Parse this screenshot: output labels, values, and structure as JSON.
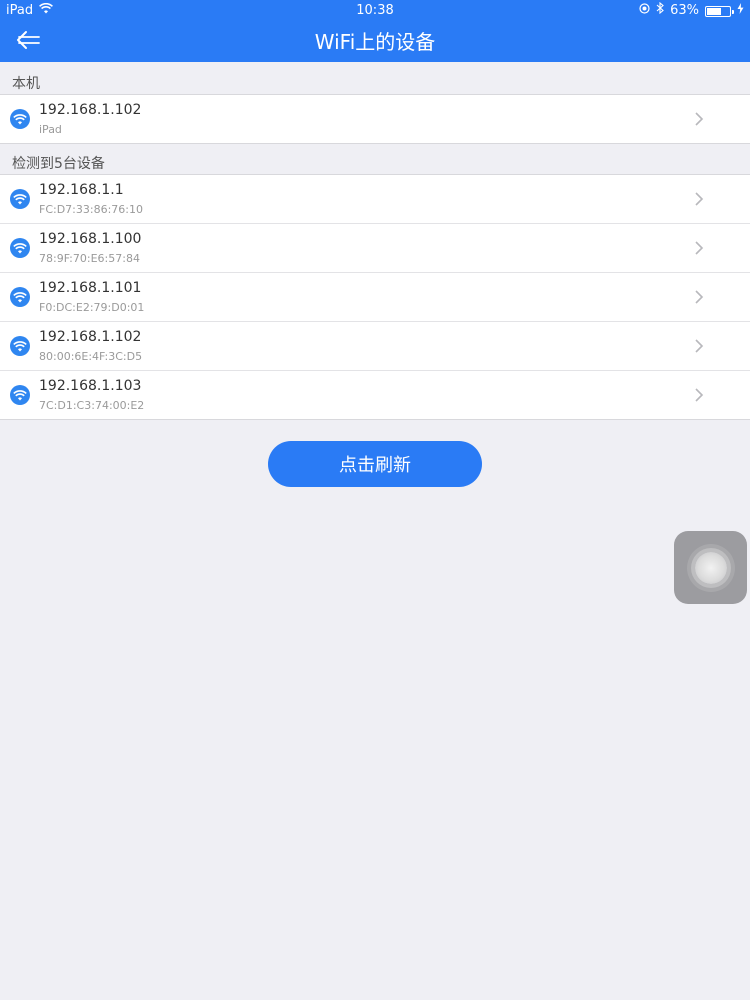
{
  "status_bar": {
    "device": "iPad",
    "time": "10:38",
    "battery": "63%",
    "battery_level": 0.63
  },
  "nav": {
    "title": "WiFi上的设备"
  },
  "local_section": {
    "header": "本机",
    "items": [
      {
        "ip": "192.168.1.102",
        "sub": "iPad"
      }
    ]
  },
  "detected_section": {
    "header": "检测到5台设备",
    "items": [
      {
        "ip": "192.168.1.1",
        "sub": "FC:D7:33:86:76:10"
      },
      {
        "ip": "192.168.1.100",
        "sub": "78:9F:70:E6:57:84"
      },
      {
        "ip": "192.168.1.101",
        "sub": "F0:DC:E2:79:D0:01"
      },
      {
        "ip": "192.168.1.102",
        "sub": "80:00:6E:4F:3C:D5"
      },
      {
        "ip": "192.168.1.103",
        "sub": "7C:D1:C3:74:00:E2"
      }
    ]
  },
  "actions": {
    "refresh_label": "点击刷新"
  },
  "colors": {
    "accent": "#2a7bf5",
    "wifi_icon": "#2f86f0",
    "background": "#efeff4"
  },
  "icons": [
    "wifi-signal-icon",
    "location-icon",
    "bluetooth-icon",
    "battery-icon",
    "charging-icon",
    "back-arrow-icon",
    "chevron-right-icon",
    "assistive-touch-icon"
  ]
}
